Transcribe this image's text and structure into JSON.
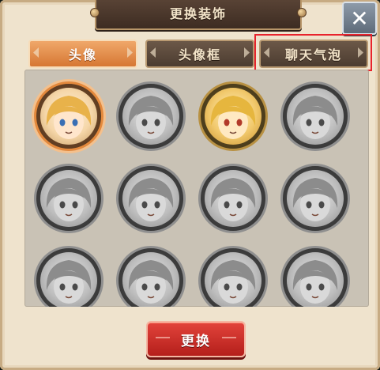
{
  "dialog": {
    "title": "更换装饰",
    "close_icon": "close-x-icon"
  },
  "tabs": [
    {
      "label": "头像",
      "active": true
    },
    {
      "label": "头像框",
      "active": false
    },
    {
      "label": "聊天气泡",
      "active": false,
      "highlighted": true
    }
  ],
  "avatars": [
    {
      "state": "selected",
      "style": "color"
    },
    {
      "state": "locked",
      "style": "gray"
    },
    {
      "state": "owned",
      "style": "gold"
    },
    {
      "state": "locked",
      "style": "gray"
    },
    {
      "state": "locked",
      "style": "gray"
    },
    {
      "state": "locked",
      "style": "gray"
    },
    {
      "state": "locked",
      "style": "gray"
    },
    {
      "state": "locked",
      "style": "gray"
    },
    {
      "state": "locked",
      "style": "gray"
    },
    {
      "state": "locked",
      "style": "gray"
    },
    {
      "state": "locked",
      "style": "gray"
    },
    {
      "state": "locked",
      "style": "gray"
    }
  ],
  "footer": {
    "confirm_label": "更换"
  },
  "colors": {
    "highlight": "#e8232c",
    "active_tab": "#e48a45",
    "confirm": "#cc2f2a"
  }
}
